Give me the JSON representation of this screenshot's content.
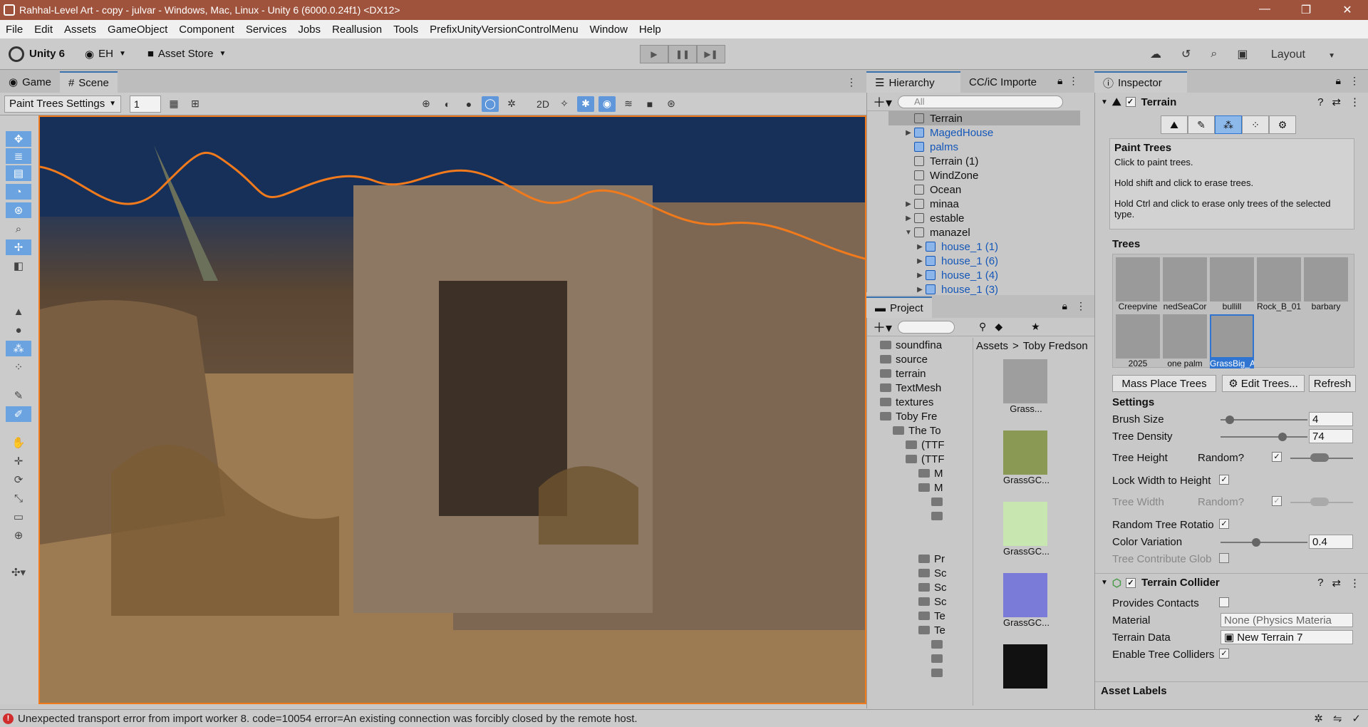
{
  "title": "Rahhal-Level Art - copy - julvar - Windows, Mac, Linux - Unity 6 (6000.0.24f1) <DX12>",
  "menu": [
    "File",
    "Edit",
    "Assets",
    "GameObject",
    "Component",
    "Services",
    "Jobs",
    "Reallusion",
    "Tools",
    "PrefixUnityVersionControlMenu",
    "Window",
    "Help"
  ],
  "toolbar": {
    "unity": "Unity 6",
    "account": "EH",
    "store": "Asset Store",
    "layout": "Layout"
  },
  "tabs": {
    "game": "Game",
    "scene": "Scene",
    "hierarchy": "Hierarchy",
    "cc": "CC/iC Importe",
    "project": "Project",
    "inspector": "Inspector"
  },
  "scene": {
    "settings": "Paint Trees Settings",
    "value": "1"
  },
  "hierarchy": {
    "search": "All",
    "items": [
      {
        "name": "Terrain",
        "blue": false,
        "indent": 0,
        "arrow": ""
      },
      {
        "name": "MagedHouse",
        "blue": true,
        "indent": 0,
        "arrow": "▶"
      },
      {
        "name": "palms",
        "blue": true,
        "indent": 0,
        "arrow": ""
      },
      {
        "name": "Terrain (1)",
        "blue": false,
        "indent": 0,
        "arrow": ""
      },
      {
        "name": "WindZone",
        "blue": false,
        "indent": 0,
        "arrow": ""
      },
      {
        "name": "Ocean",
        "blue": false,
        "indent": 0,
        "arrow": ""
      },
      {
        "name": "minaa",
        "blue": false,
        "indent": 0,
        "arrow": "▶"
      },
      {
        "name": "estable",
        "blue": false,
        "indent": 0,
        "arrow": "▶"
      },
      {
        "name": "manazel",
        "blue": false,
        "indent": 0,
        "arrow": "▼"
      },
      {
        "name": "house_1 (1)",
        "blue": true,
        "indent": 1,
        "arrow": "▶"
      },
      {
        "name": "house_1 (6)",
        "blue": true,
        "indent": 1,
        "arrow": "▶"
      },
      {
        "name": "house_1 (4)",
        "blue": true,
        "indent": 1,
        "arrow": "▶"
      },
      {
        "name": "house_1 (3)",
        "blue": true,
        "indent": 1,
        "arrow": "▶"
      }
    ]
  },
  "project": {
    "breadcrumb": [
      "Assets",
      "Toby Fredson"
    ],
    "tree": [
      {
        "name": "soundfina",
        "indent": 1
      },
      {
        "name": "source",
        "indent": 1
      },
      {
        "name": "terrain",
        "indent": 1
      },
      {
        "name": "TextMesh",
        "indent": 1
      },
      {
        "name": "textures",
        "indent": 1
      },
      {
        "name": "Toby Fre",
        "indent": 1
      },
      {
        "name": "The To",
        "indent": 2
      },
      {
        "name": "(TTF",
        "indent": 3
      },
      {
        "name": "(TTF",
        "indent": 3
      },
      {
        "name": "M",
        "indent": 4
      },
      {
        "name": "M",
        "indent": 4
      },
      {
        "name": "",
        "indent": 5
      },
      {
        "name": "",
        "indent": 5
      }
    ],
    "tree2": [
      {
        "name": "Pr",
        "indent": 4
      },
      {
        "name": "Sc",
        "indent": 4
      },
      {
        "name": "Sc",
        "indent": 4
      },
      {
        "name": "Sc",
        "indent": 4
      },
      {
        "name": "Te",
        "indent": 4
      },
      {
        "name": "Te",
        "indent": 4
      },
      {
        "name": "",
        "indent": 5
      },
      {
        "name": "",
        "indent": 5
      },
      {
        "name": "",
        "indent": 5
      }
    ],
    "assets": [
      "Grass...",
      "GrassGC...",
      "GrassGC...",
      "GrassGC..."
    ]
  },
  "inspector": {
    "component": "Terrain",
    "paint_title": "Paint Trees",
    "desc": [
      "Click to paint trees.",
      "Hold shift and click to erase trees.",
      "Hold Ctrl and click to erase only trees of the selected type."
    ],
    "trees_label": "Trees",
    "trees": [
      "Creepvine",
      "nedSeaCor",
      "bullill",
      "Rock_B_01",
      "barbary",
      "2025",
      "one palm",
      "GrassBig_A"
    ],
    "btn_mass": "Mass Place Trees",
    "btn_edit": "Edit Trees...",
    "btn_refresh": "Refresh",
    "settings_label": "Settings",
    "brush_size_label": "Brush Size",
    "brush_size": "4",
    "brush_size_frac": 0.06,
    "density_label": "Tree Density",
    "density": "74",
    "density_frac": 0.74,
    "height_label": "Tree Height",
    "random": "Random?",
    "lock_label": "Lock Width to Height",
    "width_label": "Tree Width",
    "rot_label": "Random Tree Rotatio",
    "color_label": "Color Variation",
    "color": "0.4",
    "color_frac": 0.4,
    "contrib_label": "Tree Contribute Glob",
    "collider": "Terrain Collider",
    "contacts_label": "Provides Contacts",
    "material_label": "Material",
    "material": "None (Physics Materia",
    "tdata_label": "Terrain Data",
    "tdata": "New Terrain 7",
    "enable_label": "Enable Tree Colliders",
    "labels": "Asset Labels"
  },
  "status": "Unexpected transport error from import worker 8. code=10054 error=An existing connection was forcibly closed by the remote host.",
  "colors": {
    "accent": "#2f74d0",
    "title": "#a0533c",
    "selection": "#f07a1c"
  }
}
